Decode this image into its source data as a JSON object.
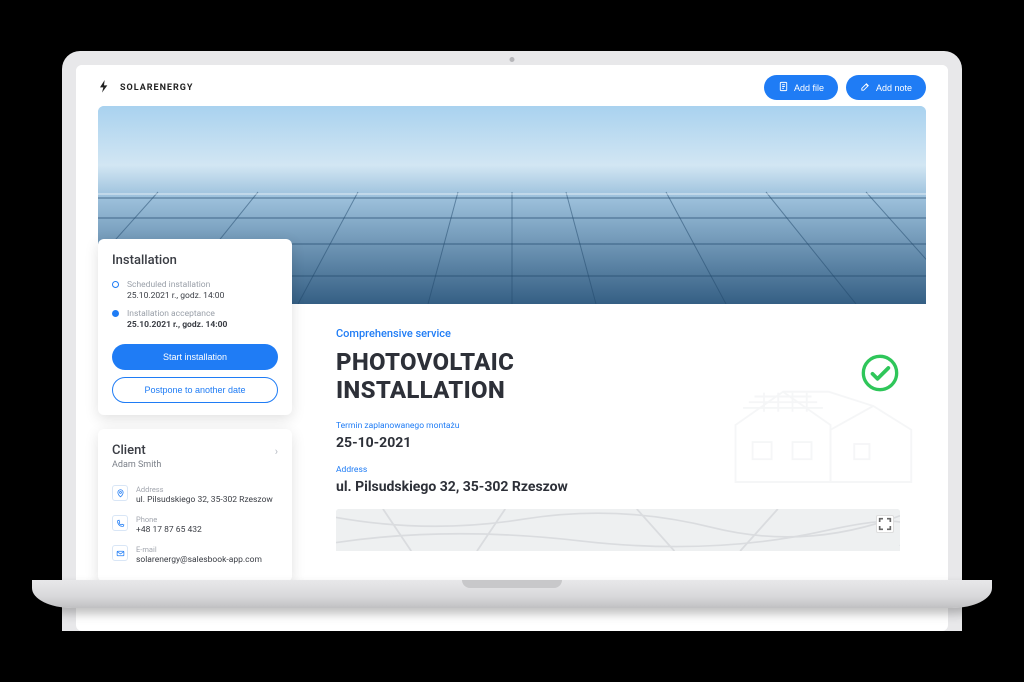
{
  "brand": {
    "name": "SOLARENERGY"
  },
  "header": {
    "add_file": "Add file",
    "add_note": "Add note"
  },
  "sidebar": {
    "installation": {
      "title": "Installation",
      "items": [
        {
          "label": "Scheduled installation",
          "value": "25.10.2021 r., godz. 14:00"
        },
        {
          "label": "Installation acceptance",
          "value": "25.10.2021 r., godz. 14:00"
        }
      ],
      "start_btn": "Start installation",
      "postpone_btn": "Postpone to another date"
    },
    "client": {
      "title": "Client",
      "name": "Adam Smith",
      "contacts": [
        {
          "label": "Address",
          "value": "ul. Pilsudskiego 32, 35-302 Rzeszow"
        },
        {
          "label": "Phone",
          "value": "+48 17 87 65 432"
        },
        {
          "label": "E-mail",
          "value": "solarenergy@salesbook-app.com"
        }
      ]
    }
  },
  "main": {
    "service_label": "Comprehensive service",
    "title": "PHOTOVOLTAIC INSTALLATION",
    "date_label": "Termin zaplanowanego montażu",
    "date_value": "25-10-2021",
    "address_label": "Address",
    "address_value": "ul. Pilsudskiego 32, 35-302 Rzeszow"
  }
}
